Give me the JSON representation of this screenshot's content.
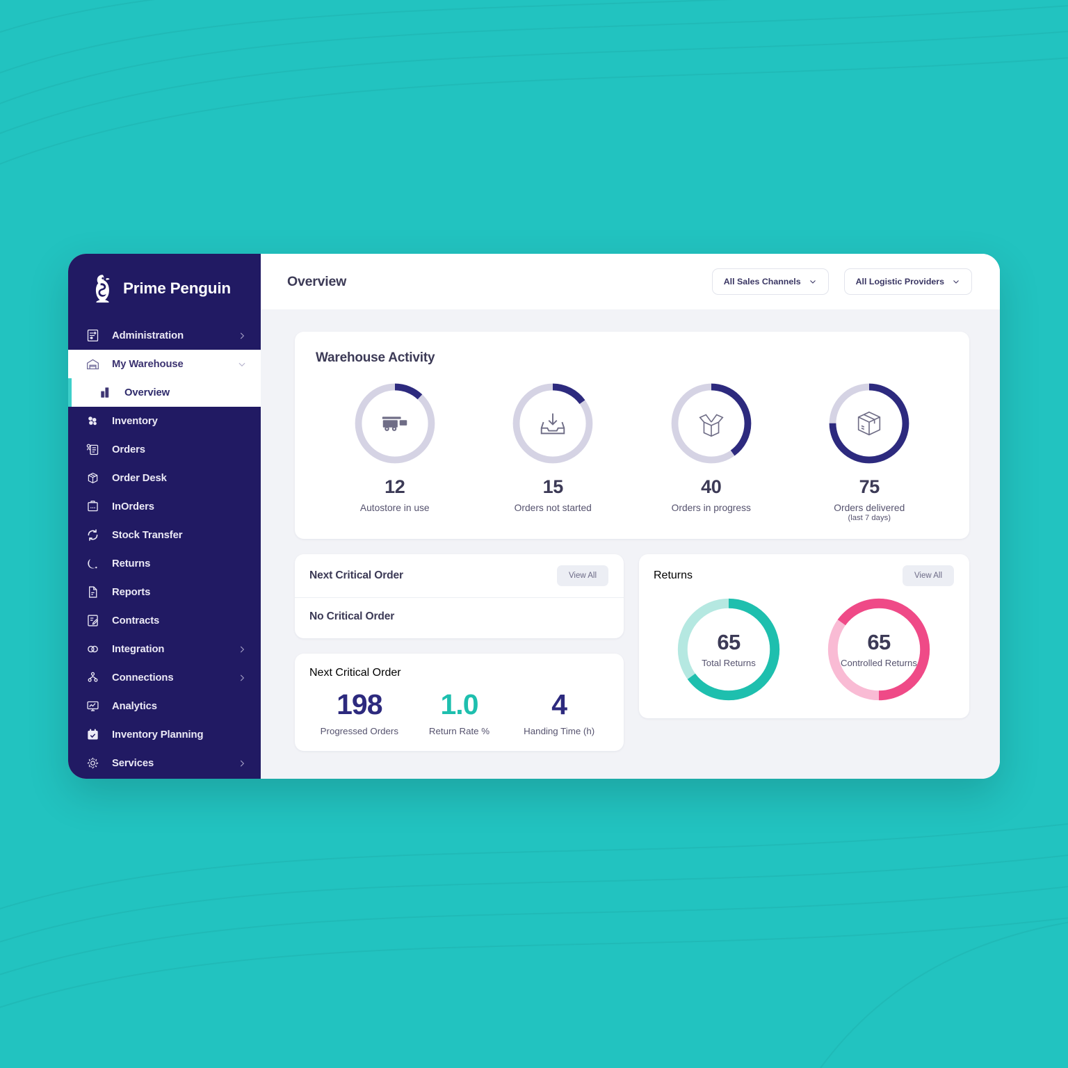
{
  "theme": {
    "background_teal": "#22c3c0",
    "sidebar_navy": "#211a63",
    "accent_teal": "#3ecfc9",
    "donut_blue": "#2d2a7e",
    "donut_track": "#d5d3e4",
    "returns_teal": "#1ebfae",
    "returns_teal_light": "#b5e8e1",
    "returns_pink": "#ef4a87",
    "returns_pink_light": "#f9bbd4"
  },
  "brand": {
    "name": "Prime Penguin",
    "logo_icon": "penguin-icon"
  },
  "sidebar": {
    "items": [
      {
        "label": "Administration",
        "icon": "sliders-document-icon",
        "chevron": "chevron-right",
        "state": "default"
      },
      {
        "label": "My Warehouse",
        "icon": "warehouse-icon",
        "chevron": "chevron-down",
        "state": "expanded"
      },
      {
        "label": "Overview",
        "icon": "bar-chart-icon",
        "chevron": "",
        "state": "active"
      },
      {
        "label": "Inventory",
        "icon": "boxes-icon",
        "chevron": "",
        "state": "default"
      },
      {
        "label": "Orders",
        "icon": "order-list-icon",
        "chevron": "",
        "state": "default"
      },
      {
        "label": "Order Desk",
        "icon": "package-cube-icon",
        "chevron": "",
        "state": "default"
      },
      {
        "label": "InOrders",
        "icon": "clipboard-icon",
        "chevron": "",
        "state": "default"
      },
      {
        "label": "Stock Transfer",
        "icon": "refresh-cycle-icon",
        "chevron": "",
        "state": "default"
      },
      {
        "label": "Returns",
        "icon": "return-arrow-icon",
        "chevron": "",
        "state": "default"
      },
      {
        "label": "Reports",
        "icon": "report-file-icon",
        "chevron": "",
        "state": "default"
      },
      {
        "label": "Contracts",
        "icon": "contract-pen-icon",
        "chevron": "",
        "state": "default"
      },
      {
        "label": "Integration",
        "icon": "links-icon",
        "chevron": "chevron-right",
        "state": "default"
      },
      {
        "label": "Connections",
        "icon": "nodes-icon",
        "chevron": "chevron-right",
        "state": "default"
      },
      {
        "label": "Analytics",
        "icon": "monitor-chart-icon",
        "chevron": "",
        "state": "default"
      },
      {
        "label": "Inventory Planning",
        "icon": "calendar-check-icon",
        "chevron": "",
        "state": "default"
      },
      {
        "label": "Services",
        "icon": "gear-icon",
        "chevron": "chevron-right",
        "state": "default"
      }
    ]
  },
  "topbar": {
    "title": "Overview",
    "filters": [
      {
        "label": "All Sales Channels",
        "icon": "chevron-down-icon"
      },
      {
        "label": "All Logistic Providers",
        "icon": "chevron-down-icon"
      }
    ]
  },
  "warehouse_activity": {
    "title": "Warehouse Activity",
    "stats": [
      {
        "value": "12",
        "label": "Autostore in use",
        "sub": "",
        "percent": 12,
        "icon": "trailer-cart-icon"
      },
      {
        "value": "15",
        "label": "Orders not started",
        "sub": "",
        "percent": 15,
        "icon": "inbox-download-icon"
      },
      {
        "value": "40",
        "label": "Orders in progress",
        "sub": "",
        "percent": 40,
        "icon": "open-box-icon"
      },
      {
        "value": "75",
        "label": "Orders delivered",
        "sub": "(last 7 days)",
        "percent": 75,
        "icon": "closed-box-icon"
      }
    ]
  },
  "next_critical_order": {
    "title": "Next Critical Order",
    "view_all": "View All",
    "empty_text": "No Critical Order"
  },
  "metrics_card": {
    "title": "Next Critical Order",
    "metrics": [
      {
        "value": "198",
        "label": "Progressed Orders",
        "color": "#2d2a7e"
      },
      {
        "value": "1.0",
        "label": "Return Rate %",
        "color": "#1ebfae"
      },
      {
        "value": "4",
        "label": "Handing Time (h)",
        "color": "#2d2a7e"
      }
    ]
  },
  "returns": {
    "title": "Returns",
    "view_all": "View All",
    "donuts": [
      {
        "value": "65",
        "label": "Total Returns",
        "percent": 65,
        "color": "#1ebfae",
        "track": "#b5e8e1",
        "direction": "clockwise"
      },
      {
        "value": "65",
        "label": "Controlled Returns",
        "percent": 65,
        "color": "#ef4a87",
        "track": "#f9bbd4",
        "direction": "counter-clockwise"
      }
    ]
  },
  "chart_data": [
    {
      "type": "pie",
      "title": "Warehouse Activity",
      "legend": "donut gauges",
      "categories": [
        "Autostore in use",
        "Orders not started",
        "Orders in progress",
        "Orders delivered (last 7 days)"
      ],
      "values": [
        12,
        15,
        40,
        75
      ],
      "ylim": [
        0,
        100
      ],
      "ylabel": "percent of ring filled"
    },
    {
      "type": "pie",
      "title": "Returns",
      "categories": [
        "Total Returns",
        "Controlled Returns"
      ],
      "values": [
        65,
        65
      ],
      "ylim": [
        0,
        100
      ],
      "ylabel": "percent of ring filled"
    },
    {
      "type": "bar",
      "title": "Next Critical Order",
      "categories": [
        "Progressed Orders",
        "Return Rate %",
        "Handing Time (h)"
      ],
      "values": [
        198,
        1.0,
        4
      ]
    }
  ]
}
